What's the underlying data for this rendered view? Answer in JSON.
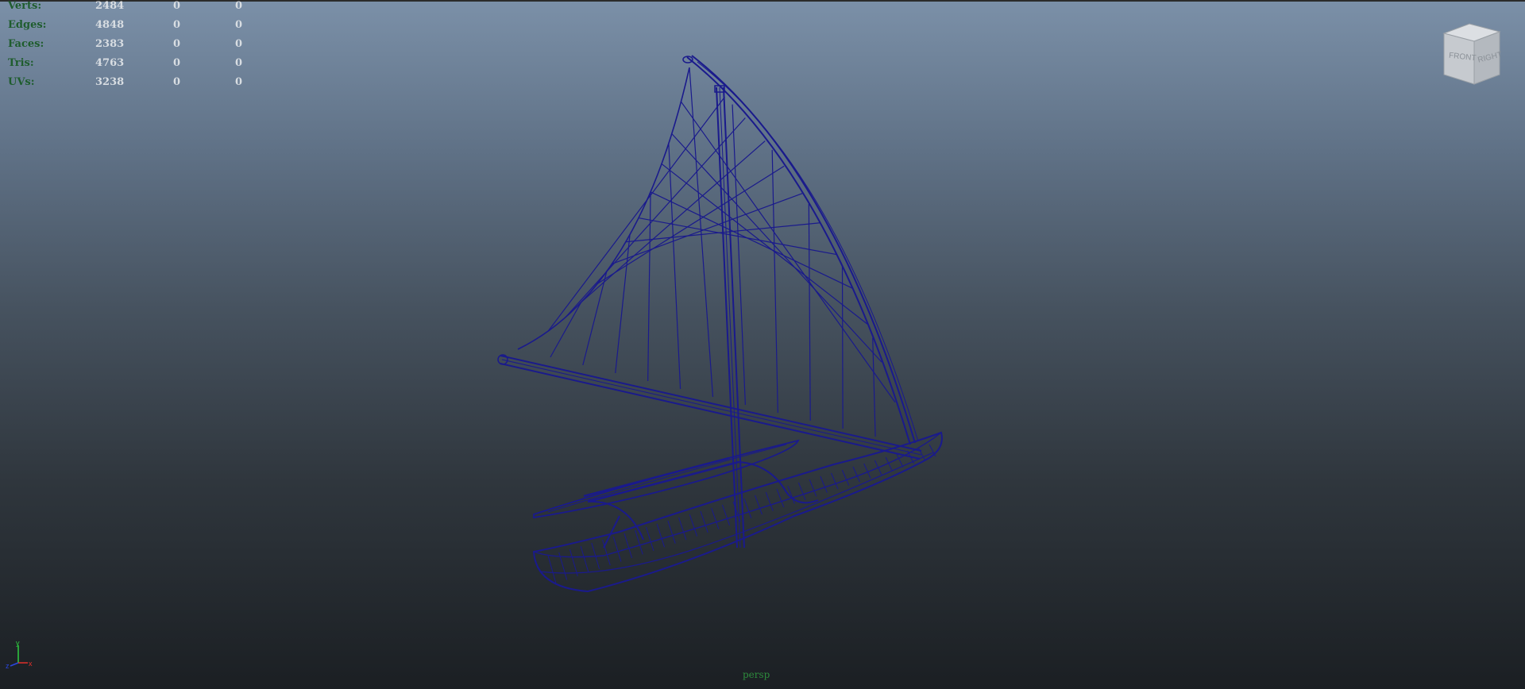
{
  "stats": [
    {
      "label": "Verts:",
      "v1": "2484",
      "v2": "0",
      "v3": "0"
    },
    {
      "label": "Edges:",
      "v1": "4848",
      "v2": "0",
      "v3": "0"
    },
    {
      "label": "Faces:",
      "v1": "2383",
      "v2": "0",
      "v3": "0"
    },
    {
      "label": "Tris:",
      "v1": "4763",
      "v2": "0",
      "v3": "0"
    },
    {
      "label": "UVs:",
      "v1": "3238",
      "v2": "0",
      "v3": "0"
    }
  ],
  "viewcube": {
    "front": "FRONT",
    "right": "RIGHT"
  },
  "axis": {
    "y": "y",
    "x": "x",
    "z": "z"
  },
  "camera": "persp",
  "colors": {
    "wireframe": "#1a1a8c",
    "hud_label": "#1f5d2e",
    "camera_label": "#2d8a3c"
  }
}
